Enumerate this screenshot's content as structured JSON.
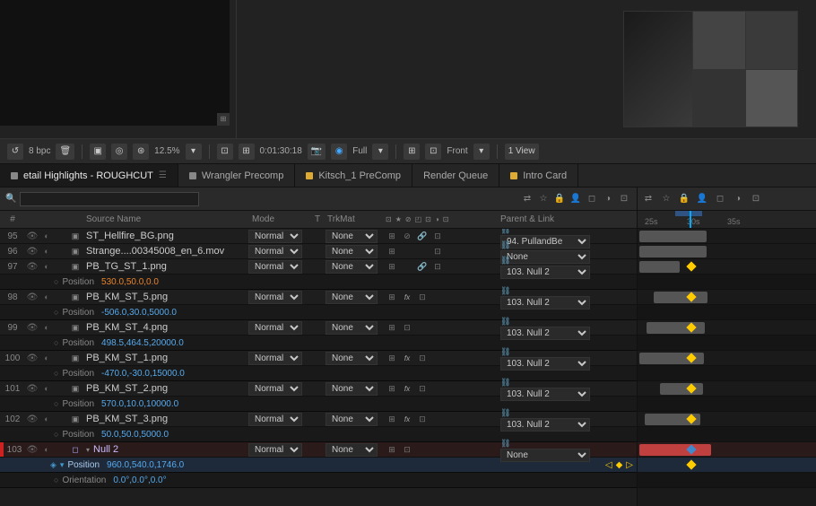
{
  "toolbar": {
    "bpc": "8 bpc",
    "trash_icon": "🗑",
    "zoom": "12.5%",
    "timecode": "0:01:30:18",
    "camera_icon": "📷",
    "quality": "Full",
    "view": "Front",
    "layout": "1 View"
  },
  "tabs": [
    {
      "label": "etail Highlights - ROUGHCUT",
      "active": true,
      "dot_color": "#888"
    },
    {
      "label": "Wrangler Precomp",
      "active": false,
      "dot_color": "#888"
    },
    {
      "label": "Kitsch_1 PreComp",
      "active": false,
      "dot_color": "#ddaa33"
    },
    {
      "label": "Render Queue",
      "active": false,
      "dot_color": null
    },
    {
      "label": "Intro Card",
      "active": false,
      "dot_color": "#ddaa33"
    }
  ],
  "columns": {
    "num": "#",
    "source": "Source Name",
    "mode": "Mode",
    "t": "T",
    "trkmat": "TrkMat",
    "parent": "Parent & Link"
  },
  "layers": [
    {
      "id": 95,
      "name": "ST_Hellfire_BG.png",
      "mode": "Normal",
      "trkmat": "None",
      "parent": "94. PullandBe",
      "has_link": true,
      "has_fx": false,
      "color": "gray",
      "tl_start": 5,
      "tl_width": 55
    },
    {
      "id": 96,
      "name": "Strange....00345008_en_6.mov",
      "mode": "Normal",
      "trkmat": "None",
      "parent": "None",
      "has_link": false,
      "has_fx": false,
      "color": "gray",
      "tl_start": 5,
      "tl_width": 55
    },
    {
      "id": 97,
      "name": "PB_TG_ST_1.png",
      "mode": "Normal",
      "trkmat": "None",
      "parent": "103. Null 2",
      "has_link": true,
      "has_fx": false,
      "color": "gray",
      "tl_start": 5,
      "tl_width": 30,
      "position_value": "530.0,50.0,0.0",
      "position_color": "orange"
    },
    {
      "id": 98,
      "name": "PB_KM_ST_5.png",
      "mode": "Normal",
      "trkmat": "None",
      "parent": "103. Null 2",
      "has_link": false,
      "has_fx": true,
      "color": "gray",
      "tl_start": 15,
      "tl_width": 45,
      "position_value": "-506.0,30.0,5000.0",
      "position_color": "blue"
    },
    {
      "id": 99,
      "name": "PB_KM_ST_4.png",
      "mode": "Normal",
      "trkmat": "None",
      "parent": "103. Null 2",
      "has_link": false,
      "has_fx": false,
      "color": "gray",
      "tl_start": 10,
      "tl_width": 50,
      "position_value": "498.5,464.5,20000.0",
      "position_color": "blue"
    },
    {
      "id": 100,
      "name": "PB_KM_ST_1.png",
      "mode": "Normal",
      "trkmat": "None",
      "parent": "103. Null 2",
      "has_link": false,
      "has_fx": true,
      "color": "gray",
      "tl_start": 0,
      "tl_width": 55,
      "position_value": "-470.0,-30.0,15000.0",
      "position_color": "blue"
    },
    {
      "id": 101,
      "name": "PB_KM_ST_2.png",
      "mode": "Normal",
      "trkmat": "None",
      "parent": "103. Null 2",
      "has_link": false,
      "has_fx": true,
      "color": "gray",
      "tl_start": 20,
      "tl_width": 35,
      "position_value": "570.0,10.0,10000.0",
      "position_color": "blue"
    },
    {
      "id": 102,
      "name": "PB_KM_ST_3.png",
      "mode": "Normal",
      "trkmat": "None",
      "parent": "103. Null 2",
      "has_link": false,
      "has_fx": true,
      "color": "gray",
      "tl_start": 8,
      "tl_width": 47,
      "position_value": "50.0,50.0,5000.0",
      "position_color": "blue"
    },
    {
      "id": 103,
      "name": "Null 2",
      "mode": "Normal",
      "trkmat": "None",
      "parent": "None",
      "has_link": false,
      "has_fx": false,
      "color": "red",
      "is_null": true,
      "tl_start": 0,
      "tl_width": 60,
      "position_value": "960.0,540.0,1746.0",
      "orientation_value": "0.0°,0.0°,0.0°",
      "is_expanded": true
    }
  ],
  "timeline": {
    "marks": [
      "25s",
      "30s",
      "35s"
    ],
    "mark_positions": [
      10,
      55,
      100
    ]
  }
}
